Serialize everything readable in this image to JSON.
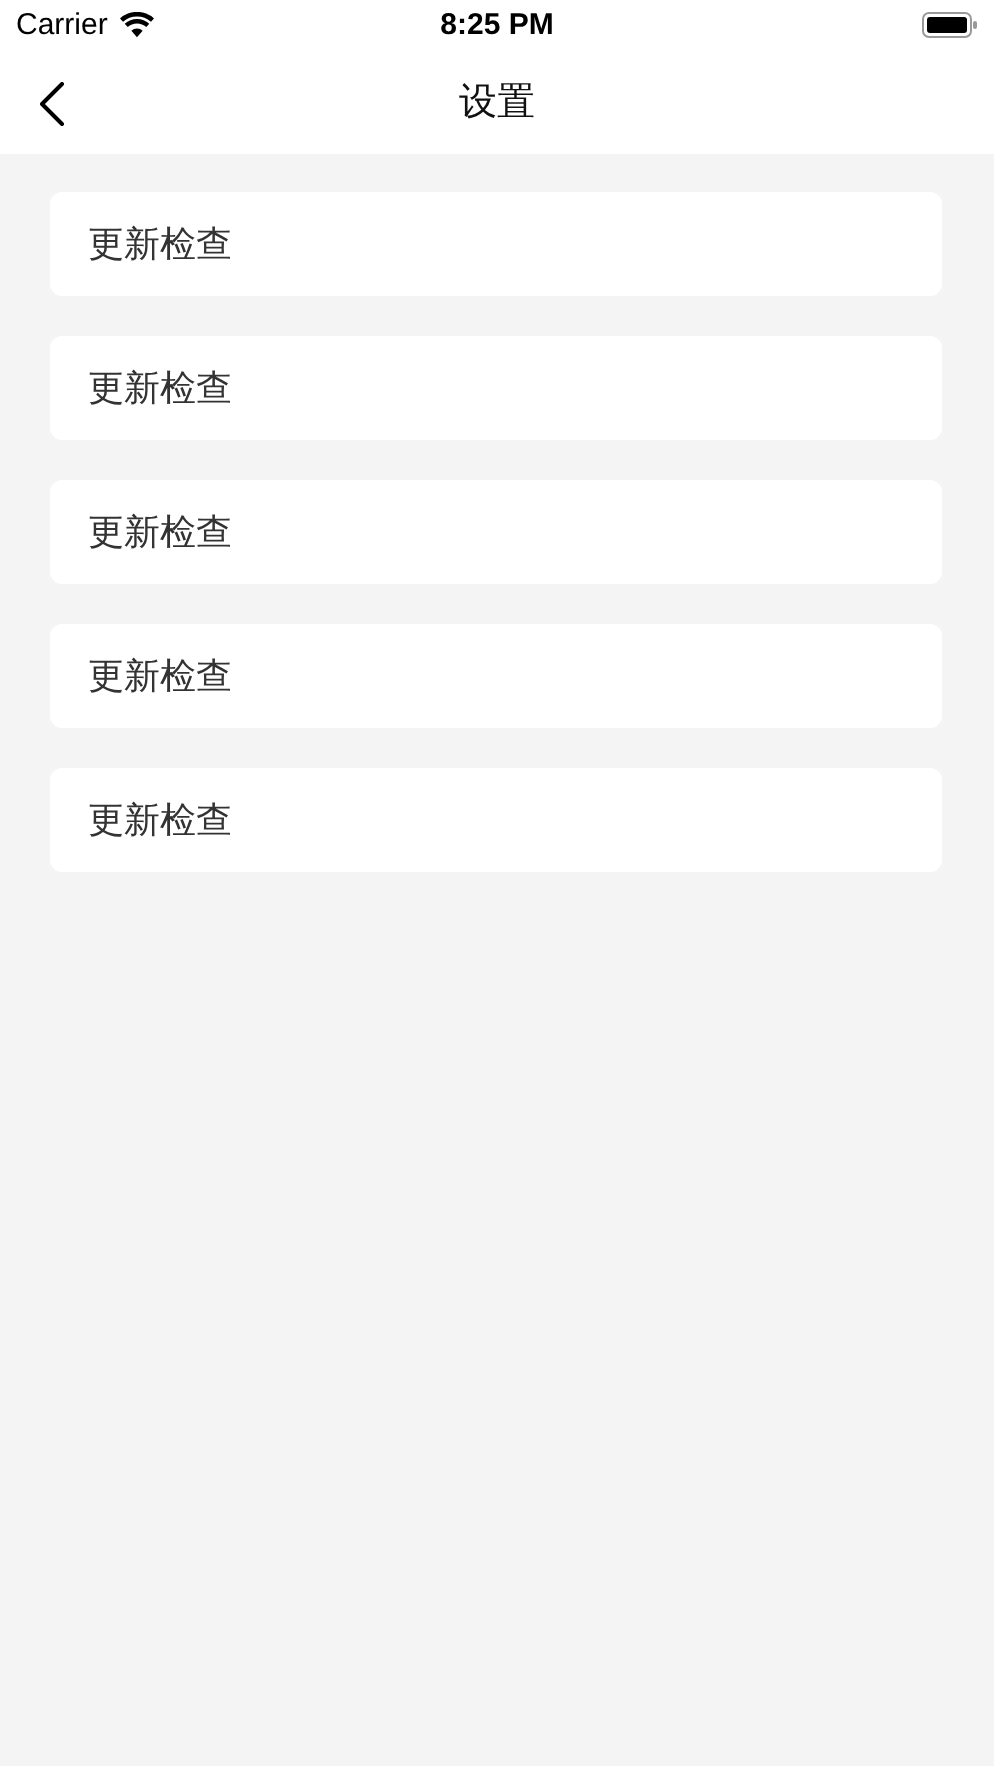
{
  "status_bar": {
    "carrier": "Carrier",
    "time": "8:25 PM"
  },
  "nav_bar": {
    "title": "设置"
  },
  "items": [
    {
      "label": "更新检查"
    },
    {
      "label": "更新检查"
    },
    {
      "label": "更新检查"
    },
    {
      "label": "更新检查"
    },
    {
      "label": "更新检查"
    }
  ]
}
